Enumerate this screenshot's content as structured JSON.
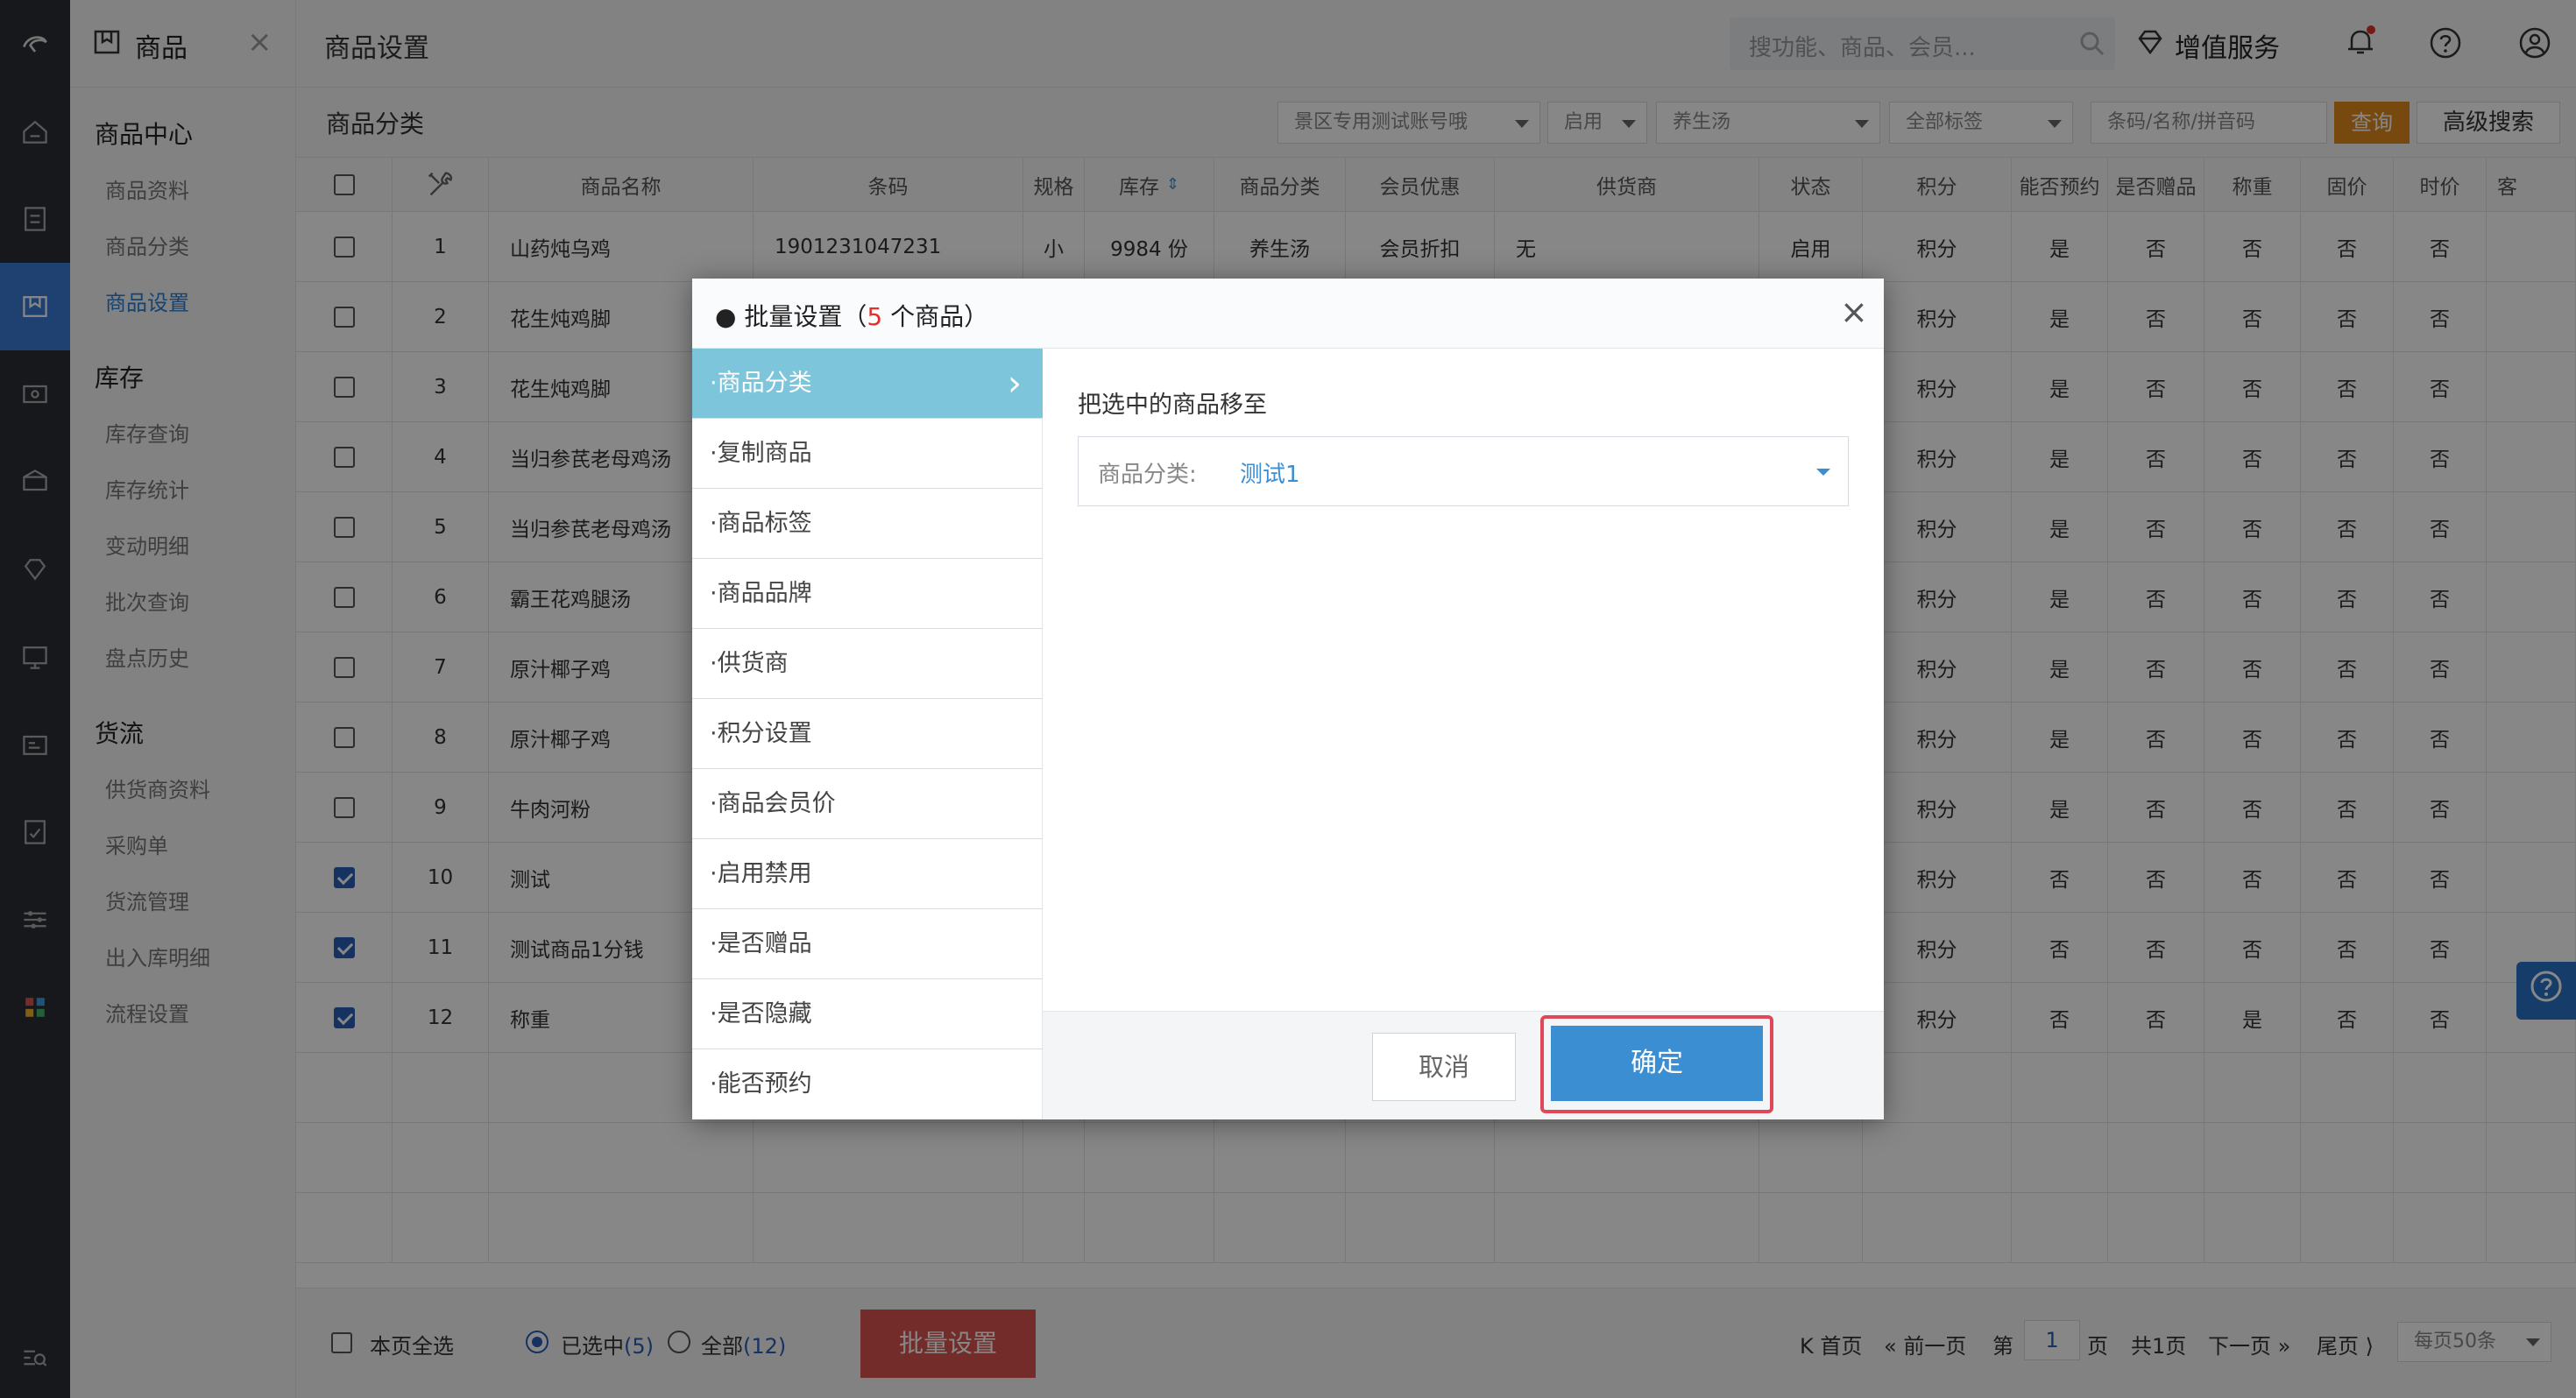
{
  "app": {
    "section_title": "商品",
    "page_title": "商品设置"
  },
  "topbar": {
    "search_placeholder": "搜功能、商品、会员...",
    "value_service": "增值服务"
  },
  "sidebar": {
    "groups": [
      {
        "title": "商品中心",
        "items": [
          "商品资料",
          "商品分类",
          "商品设置"
        ]
      },
      {
        "title": "库存",
        "items": [
          "库存查询",
          "库存统计",
          "变动明细",
          "批次查询",
          "盘点历史"
        ]
      },
      {
        "title": "货流",
        "items": [
          "供货商资料",
          "采购单",
          "货流管理",
          "出入库明细",
          "流程设置"
        ]
      }
    ],
    "active_item": "商品设置"
  },
  "filter": {
    "title": "商品分类",
    "account": "景区专用测试账号哦",
    "status": "启用",
    "category": "养生汤",
    "tags": "全部标签",
    "search_placeholder": "条码/名称/拼音码",
    "query_button": "查询",
    "advanced_button": "高级搜索"
  },
  "table": {
    "headers": [
      "商品名称",
      "条码",
      "规格",
      "库存",
      "商品分类",
      "会员优惠",
      "供货商",
      "状态",
      "积分",
      "能否预约",
      "是否赠品",
      "称重",
      "固价",
      "时价",
      "客"
    ],
    "rows": [
      {
        "no": "1",
        "name": "山药炖乌鸡",
        "barcode": "1901231047231",
        "spec": "小",
        "stock": "9984 份",
        "category": "养生汤",
        "discount": "会员折扣",
        "supplier": "无",
        "status": "启用",
        "points": "积分",
        "reserve": "是",
        "gift": "否",
        "weigh": "否",
        "fixed": "否",
        "timeprice": "否",
        "checked": false
      },
      {
        "no": "2",
        "name": "花生炖鸡脚",
        "points": "积分",
        "reserve": "是",
        "gift": "否",
        "weigh": "否",
        "fixed": "否",
        "timeprice": "否",
        "checked": false
      },
      {
        "no": "3",
        "name": "花生炖鸡脚",
        "points": "积分",
        "reserve": "是",
        "gift": "否",
        "weigh": "否",
        "fixed": "否",
        "timeprice": "否",
        "checked": false
      },
      {
        "no": "4",
        "name": "当归参芪老母鸡汤",
        "points": "积分",
        "reserve": "是",
        "gift": "否",
        "weigh": "否",
        "fixed": "否",
        "timeprice": "否",
        "checked": false
      },
      {
        "no": "5",
        "name": "当归参芪老母鸡汤",
        "points": "积分",
        "reserve": "是",
        "gift": "否",
        "weigh": "否",
        "fixed": "否",
        "timeprice": "否",
        "checked": false
      },
      {
        "no": "6",
        "name": "霸王花鸡腿汤",
        "points": "积分",
        "reserve": "是",
        "gift": "否",
        "weigh": "否",
        "fixed": "否",
        "timeprice": "否",
        "checked": false
      },
      {
        "no": "7",
        "name": "原汁椰子鸡",
        "points": "积分",
        "reserve": "是",
        "gift": "否",
        "weigh": "否",
        "fixed": "否",
        "timeprice": "否",
        "checked": false
      },
      {
        "no": "8",
        "name": "原汁椰子鸡",
        "points": "积分",
        "reserve": "是",
        "gift": "否",
        "weigh": "否",
        "fixed": "否",
        "timeprice": "否",
        "checked": false
      },
      {
        "no": "9",
        "name": "牛肉河粉",
        "points": "积分",
        "reserve": "是",
        "gift": "否",
        "weigh": "否",
        "fixed": "否",
        "timeprice": "否",
        "checked": false
      },
      {
        "no": "10",
        "name": "测试",
        "points": "积分",
        "reserve": "否",
        "gift": "否",
        "weigh": "否",
        "fixed": "否",
        "timeprice": "否",
        "checked": true
      },
      {
        "no": "11",
        "name": "测试商品1分钱",
        "points": "积分",
        "reserve": "否",
        "gift": "否",
        "weigh": "否",
        "fixed": "否",
        "timeprice": "否",
        "checked": true
      },
      {
        "no": "12",
        "name": "称重",
        "points": "积分",
        "reserve": "否",
        "gift": "否",
        "weigh": "是",
        "fixed": "否",
        "timeprice": "否",
        "checked": true
      }
    ]
  },
  "footer": {
    "select_page": "本页全选",
    "selected_label": "已选中",
    "selected_count": "(5)",
    "all_label": "全部",
    "all_count": "(12)",
    "batch_button": "批量设置",
    "first": "首页",
    "prev": "前一页",
    "page_prefix": "第",
    "page_value": "1",
    "page_suffix": "页",
    "total": "共1页",
    "next": "下一页",
    "last": "尾页",
    "per_page": "每页50条"
  },
  "modal": {
    "title_prefix": "● 批量设置（",
    "count": "5",
    "title_suffix": " 个商品）",
    "menu": [
      "·商品分类",
      "·复制商品",
      "·商品标签",
      "·商品品牌",
      "·供货商",
      "·积分设置",
      "·商品会员价",
      "·启用禁用",
      "·是否赠品",
      "·是否隐藏",
      "·能否预约"
    ],
    "active_menu": "·商品分类",
    "content_label": "把选中的商品移至",
    "field_label": "商品分类:",
    "field_value": "测试1",
    "cancel": "取消",
    "confirm": "确定"
  },
  "colors": {
    "accent": "#3b8ed2",
    "active_menu": "#7cc5da",
    "highlight_border": "#e0485a",
    "batch_button": "#d9534f",
    "query_button": "#e08a1e"
  }
}
